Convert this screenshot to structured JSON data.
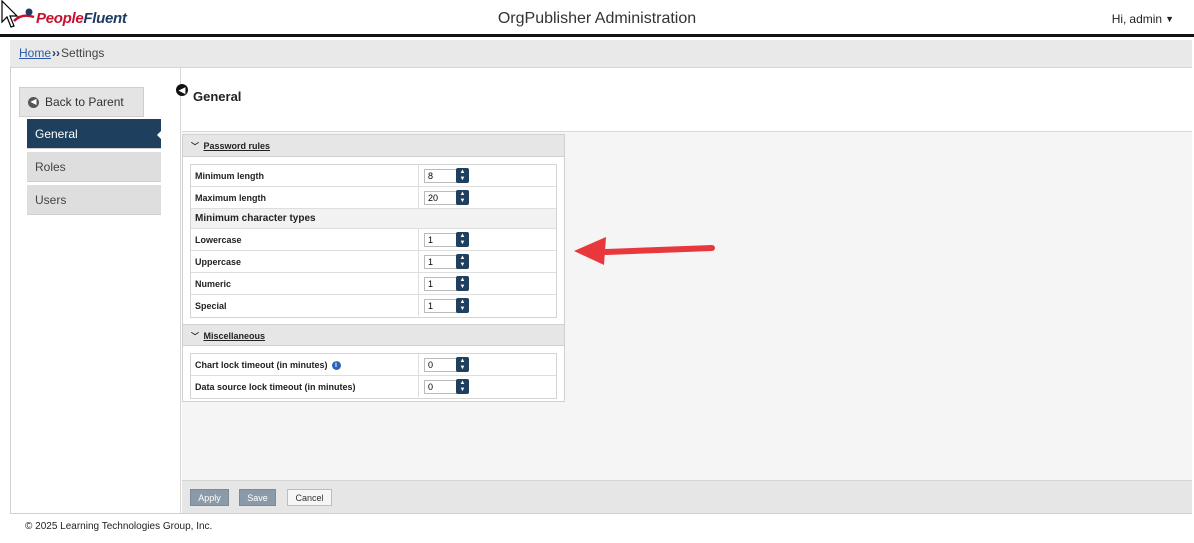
{
  "header": {
    "logo": {
      "part1": "People",
      "part2": "Fluent"
    },
    "app_title": "OrgPublisher Administration",
    "user": {
      "greeting": "Hi,",
      "name": "admin"
    }
  },
  "breadcrumb": {
    "home": "Home",
    "separator": "››",
    "current": "Settings"
  },
  "sidebar": {
    "back_label": "Back to Parent",
    "items": [
      {
        "label": "General",
        "active": true
      },
      {
        "label": "Roles",
        "active": false
      },
      {
        "label": "Users",
        "active": false
      }
    ]
  },
  "main": {
    "title": "General",
    "password_rules": {
      "title": "Password rules",
      "rows": [
        {
          "label": "Minimum length",
          "value": "8"
        },
        {
          "label": "Maximum length",
          "value": "20"
        }
      ],
      "subheading": "Minimum character types",
      "char_rows": [
        {
          "label": "Lowercase",
          "value": "1"
        },
        {
          "label": "Uppercase",
          "value": "1"
        },
        {
          "label": "Numeric",
          "value": "1"
        },
        {
          "label": "Special",
          "value": "1"
        }
      ]
    },
    "misc": {
      "title": "Miscellaneous",
      "rows": [
        {
          "label": "Chart lock timeout (in minutes)",
          "value": "0"
        },
        {
          "label": "Data source lock timeout (in minutes)",
          "value": "0"
        }
      ]
    },
    "buttons": {
      "apply": "Apply",
      "save": "Save",
      "cancel": "Cancel"
    }
  },
  "footer": {
    "copyright": "© 2025 Learning Technologies Group, Inc."
  },
  "colors": {
    "nav_active": "#1e3f5e",
    "arrow": "#e8383d",
    "brand_red": "#c8102e"
  }
}
